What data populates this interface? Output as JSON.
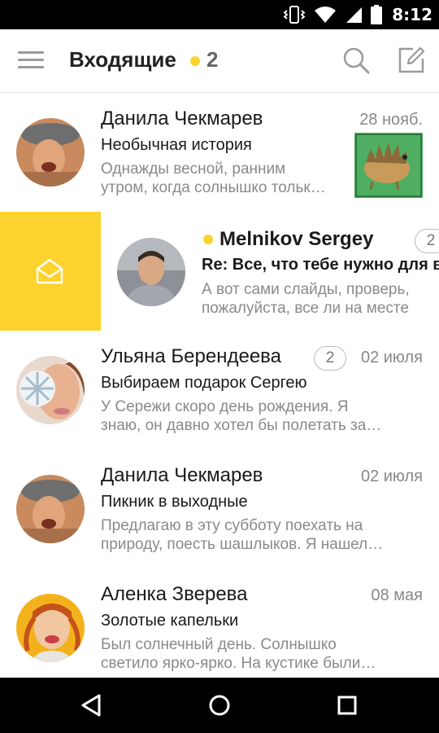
{
  "status_bar": {
    "time": "8:12"
  },
  "toolbar": {
    "title": "Входящие",
    "unread_count": "2"
  },
  "messages": [
    {
      "sender": "Данила Чекмарев",
      "date": "28 нояб.",
      "subject": "Необычная история",
      "snippet_line1": "Однажды весной, ранним",
      "snippet_line2": "утром, когда солнышко тольк…",
      "has_attachment_thumb": true
    },
    {
      "sender": "Melnikov Sergey",
      "count": "2",
      "unread": true,
      "subject": "Re: Все, что тебе нужно для в",
      "snippet_line1": "А вот сами слайды, проверь,",
      "snippet_line2": "пожалуйста, все ли на месте"
    },
    {
      "sender": "Ульяна Берендеева",
      "count": "2",
      "date": "02 июля",
      "subject": "Выбираем подарок Сергею",
      "snippet_line1": "У Сережи скоро день рождения. Я",
      "snippet_line2": "знаю, он давно хотел бы полетать за…"
    },
    {
      "sender": "Данила Чекмарев",
      "date": "02 июля",
      "subject": "Пикник в выходные",
      "snippet_line1": "Предлагаю в эту субботу поехать на",
      "snippet_line2": "природу, поесть шашлыков. Я нашел…"
    },
    {
      "sender": "Аленка Зверева",
      "date": "08 мая",
      "subject": "Золотые капельки",
      "snippet_line1": "Был солнечный день. Солнышко",
      "snippet_line2": "светило ярко-ярко. На кустике были…"
    }
  ],
  "colors": {
    "accent": "#fcd22e",
    "text_primary": "#1a1a1a",
    "text_secondary": "#8a8a8a",
    "bars": "#000000"
  },
  "icons": {
    "toolbar": [
      "menu-icon",
      "search-icon",
      "compose-icon"
    ],
    "swipe_action": "envelope-open-icon",
    "navigation": [
      "back-icon",
      "home-icon",
      "recents-icon"
    ],
    "status": [
      "vibrate-icon",
      "wifi-icon",
      "signal-icon",
      "battery-icon"
    ]
  }
}
